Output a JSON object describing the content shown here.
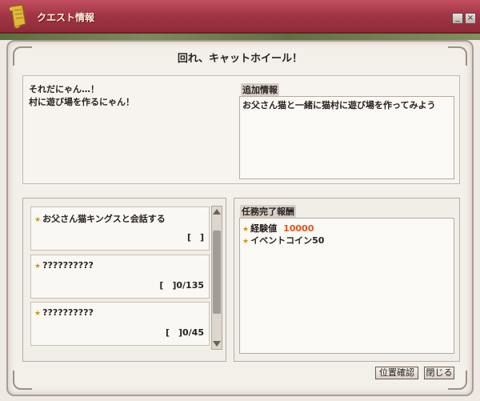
{
  "window": {
    "title": "クエスト情報",
    "minimize_label": "_",
    "close_label": "×"
  },
  "quest": {
    "name": "回れ、キャットホイール！",
    "dialog": "それだにゃん…！\n村に遊び場を作るにゃん！",
    "info_label": "追加情報",
    "info_text": "お父さん猫と一緒に猫村に遊び場を作ってみよう"
  },
  "tasks": [
    {
      "title": "お父さん猫キングスと会話する",
      "progress": "[　]"
    },
    {
      "title": "??????????",
      "progress": "[　]0/135"
    },
    {
      "title": "??????????",
      "progress": "[　]0/45"
    }
  ],
  "rewards": {
    "label": "任務完了報酬",
    "items": [
      {
        "name": "経験値",
        "value": "10000"
      },
      {
        "name": "イベントコイン50",
        "value": ""
      }
    ]
  },
  "buttons": {
    "position_confirm": "位置確認",
    "close": "閉じる"
  },
  "icons": {
    "title": "scroll-icon",
    "bullet": "star-icon"
  },
  "colors": {
    "titlebar": "#a23646",
    "reward_value": "#e0531a",
    "star": "#c79a1c"
  }
}
